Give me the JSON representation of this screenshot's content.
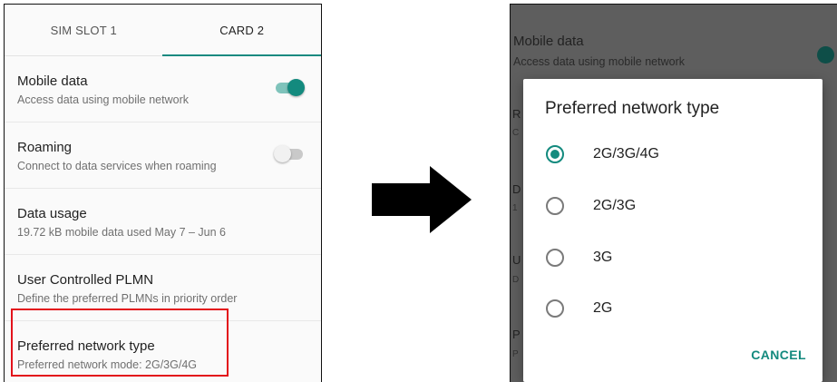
{
  "left_screen": {
    "tabs": [
      {
        "label": "SIM SLOT 1"
      },
      {
        "label": "CARD 2"
      }
    ],
    "rows": [
      {
        "title": "Mobile data",
        "subtitle": "Access data using mobile network",
        "toggle": "on"
      },
      {
        "title": "Roaming",
        "subtitle": "Connect to data services when roaming",
        "toggle": "off"
      },
      {
        "title": "Data usage",
        "subtitle": "19.72 kB mobile data used May 7 – Jun 6"
      },
      {
        "title": "User Controlled PLMN",
        "subtitle": "Define the preferred PLMNs in priority order"
      },
      {
        "title": "Preferred network type",
        "subtitle": "Preferred network mode: 2G/3G/4G",
        "highlighted": true
      }
    ]
  },
  "right_screen": {
    "background": {
      "title": "Mobile data",
      "subtitle": "Access data using mobile network",
      "letters": [
        "R",
        "C",
        "D",
        "1",
        "U",
        "D",
        "P",
        "P"
      ]
    },
    "dialog": {
      "title": "Preferred network type",
      "options": [
        {
          "label": "2G/3G/4G",
          "selected": true
        },
        {
          "label": "2G/3G",
          "selected": false
        },
        {
          "label": "3G",
          "selected": false
        },
        {
          "label": "2G",
          "selected": false
        }
      ],
      "cancel_label": "CANCEL"
    }
  },
  "colors": {
    "accent": "#138a7e",
    "highlight": "#e3121b",
    "scrim": "#5e5e5e"
  },
  "icons": {
    "arrow": "arrow-right-icon",
    "toggle": "toggle-switch-icon",
    "radio": "radio-button-icon"
  }
}
